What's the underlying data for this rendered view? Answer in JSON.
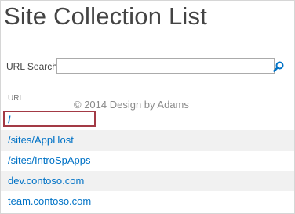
{
  "page": {
    "title": "Site Collection List"
  },
  "search": {
    "label": "URL Search",
    "value": "",
    "placeholder": ""
  },
  "table": {
    "column_header": "URL",
    "rows": [
      {
        "url": "/"
      },
      {
        "url": "/sites/AppHost"
      },
      {
        "url": "/sites/IntroSpApps"
      },
      {
        "url": "dev.contoso.com"
      },
      {
        "url": "team.contoso.com"
      }
    ]
  },
  "watermark": {
    "text": "© 2014 Design by Adams"
  },
  "colors": {
    "link": "#0072c6",
    "highlight_border": "#a33a45",
    "alt_row": "#f1f1f1"
  },
  "icons": {
    "search": "magnifier-icon"
  }
}
